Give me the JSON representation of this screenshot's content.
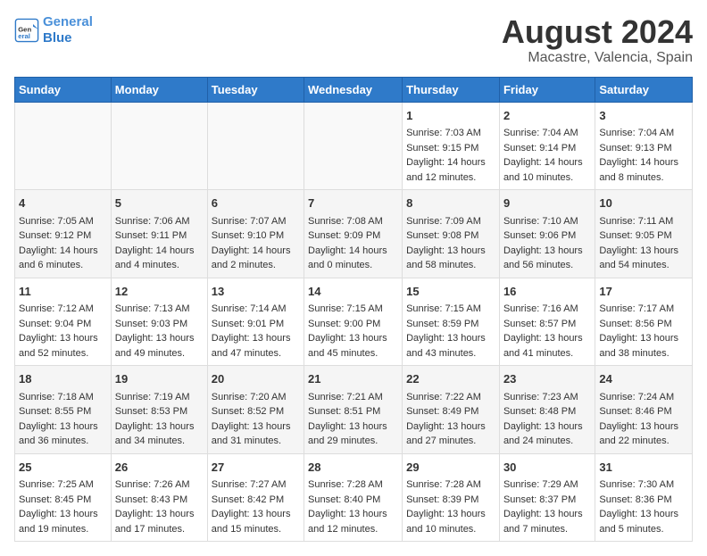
{
  "header": {
    "logo_line1": "General",
    "logo_line2": "Blue",
    "main_title": "August 2024",
    "subtitle": "Macastre, Valencia, Spain"
  },
  "days_of_week": [
    "Sunday",
    "Monday",
    "Tuesday",
    "Wednesday",
    "Thursday",
    "Friday",
    "Saturday"
  ],
  "weeks": [
    [
      {
        "day": "",
        "content": ""
      },
      {
        "day": "",
        "content": ""
      },
      {
        "day": "",
        "content": ""
      },
      {
        "day": "",
        "content": ""
      },
      {
        "day": "1",
        "content": "Sunrise: 7:03 AM\nSunset: 9:15 PM\nDaylight: 14 hours and 12 minutes."
      },
      {
        "day": "2",
        "content": "Sunrise: 7:04 AM\nSunset: 9:14 PM\nDaylight: 14 hours and 10 minutes."
      },
      {
        "day": "3",
        "content": "Sunrise: 7:04 AM\nSunset: 9:13 PM\nDaylight: 14 hours and 8 minutes."
      }
    ],
    [
      {
        "day": "4",
        "content": "Sunrise: 7:05 AM\nSunset: 9:12 PM\nDaylight: 14 hours and 6 minutes."
      },
      {
        "day": "5",
        "content": "Sunrise: 7:06 AM\nSunset: 9:11 PM\nDaylight: 14 hours and 4 minutes."
      },
      {
        "day": "6",
        "content": "Sunrise: 7:07 AM\nSunset: 9:10 PM\nDaylight: 14 hours and 2 minutes."
      },
      {
        "day": "7",
        "content": "Sunrise: 7:08 AM\nSunset: 9:09 PM\nDaylight: 14 hours and 0 minutes."
      },
      {
        "day": "8",
        "content": "Sunrise: 7:09 AM\nSunset: 9:08 PM\nDaylight: 13 hours and 58 minutes."
      },
      {
        "day": "9",
        "content": "Sunrise: 7:10 AM\nSunset: 9:06 PM\nDaylight: 13 hours and 56 minutes."
      },
      {
        "day": "10",
        "content": "Sunrise: 7:11 AM\nSunset: 9:05 PM\nDaylight: 13 hours and 54 minutes."
      }
    ],
    [
      {
        "day": "11",
        "content": "Sunrise: 7:12 AM\nSunset: 9:04 PM\nDaylight: 13 hours and 52 minutes."
      },
      {
        "day": "12",
        "content": "Sunrise: 7:13 AM\nSunset: 9:03 PM\nDaylight: 13 hours and 49 minutes."
      },
      {
        "day": "13",
        "content": "Sunrise: 7:14 AM\nSunset: 9:01 PM\nDaylight: 13 hours and 47 minutes."
      },
      {
        "day": "14",
        "content": "Sunrise: 7:15 AM\nSunset: 9:00 PM\nDaylight: 13 hours and 45 minutes."
      },
      {
        "day": "15",
        "content": "Sunrise: 7:15 AM\nSunset: 8:59 PM\nDaylight: 13 hours and 43 minutes."
      },
      {
        "day": "16",
        "content": "Sunrise: 7:16 AM\nSunset: 8:57 PM\nDaylight: 13 hours and 41 minutes."
      },
      {
        "day": "17",
        "content": "Sunrise: 7:17 AM\nSunset: 8:56 PM\nDaylight: 13 hours and 38 minutes."
      }
    ],
    [
      {
        "day": "18",
        "content": "Sunrise: 7:18 AM\nSunset: 8:55 PM\nDaylight: 13 hours and 36 minutes."
      },
      {
        "day": "19",
        "content": "Sunrise: 7:19 AM\nSunset: 8:53 PM\nDaylight: 13 hours and 34 minutes."
      },
      {
        "day": "20",
        "content": "Sunrise: 7:20 AM\nSunset: 8:52 PM\nDaylight: 13 hours and 31 minutes."
      },
      {
        "day": "21",
        "content": "Sunrise: 7:21 AM\nSunset: 8:51 PM\nDaylight: 13 hours and 29 minutes."
      },
      {
        "day": "22",
        "content": "Sunrise: 7:22 AM\nSunset: 8:49 PM\nDaylight: 13 hours and 27 minutes."
      },
      {
        "day": "23",
        "content": "Sunrise: 7:23 AM\nSunset: 8:48 PM\nDaylight: 13 hours and 24 minutes."
      },
      {
        "day": "24",
        "content": "Sunrise: 7:24 AM\nSunset: 8:46 PM\nDaylight: 13 hours and 22 minutes."
      }
    ],
    [
      {
        "day": "25",
        "content": "Sunrise: 7:25 AM\nSunset: 8:45 PM\nDaylight: 13 hours and 19 minutes."
      },
      {
        "day": "26",
        "content": "Sunrise: 7:26 AM\nSunset: 8:43 PM\nDaylight: 13 hours and 17 minutes."
      },
      {
        "day": "27",
        "content": "Sunrise: 7:27 AM\nSunset: 8:42 PM\nDaylight: 13 hours and 15 minutes."
      },
      {
        "day": "28",
        "content": "Sunrise: 7:28 AM\nSunset: 8:40 PM\nDaylight: 13 hours and 12 minutes."
      },
      {
        "day": "29",
        "content": "Sunrise: 7:28 AM\nSunset: 8:39 PM\nDaylight: 13 hours and 10 minutes."
      },
      {
        "day": "30",
        "content": "Sunrise: 7:29 AM\nSunset: 8:37 PM\nDaylight: 13 hours and 7 minutes."
      },
      {
        "day": "31",
        "content": "Sunrise: 7:30 AM\nSunset: 8:36 PM\nDaylight: 13 hours and 5 minutes."
      }
    ]
  ]
}
